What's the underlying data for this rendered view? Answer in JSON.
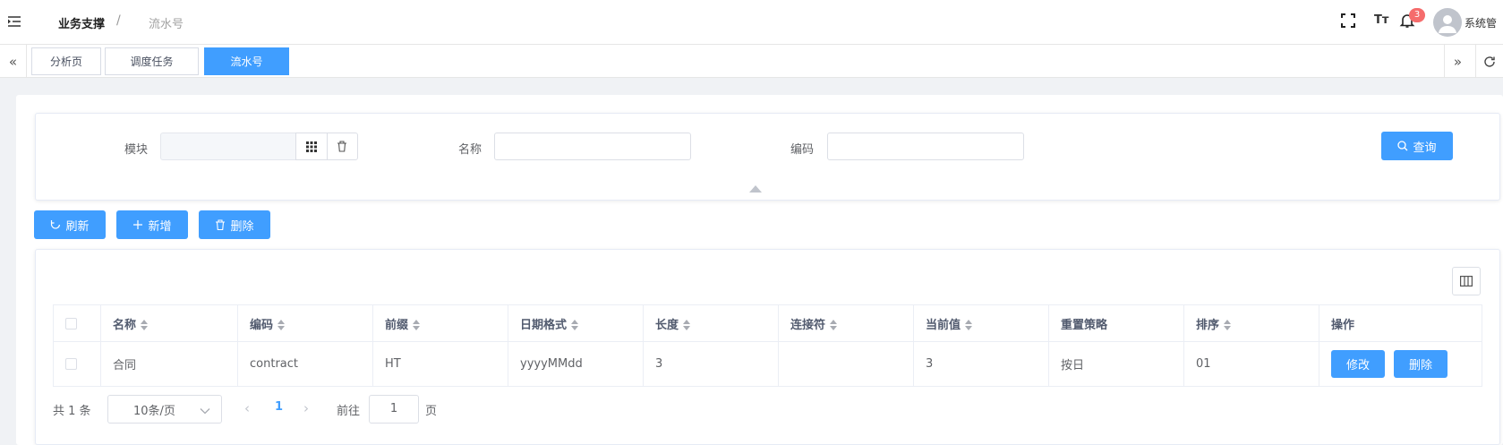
{
  "header": {
    "breadcrumb_main": "业务支撑",
    "breadcrumb_separator": "/",
    "breadcrumb_current": "流水号",
    "font_icon_text": "Tт",
    "notification_count": "3",
    "user_name": "系统管"
  },
  "tabs": [
    {
      "label": "分析页",
      "active": false
    },
    {
      "label": "调度任务",
      "active": false
    },
    {
      "label": "流水号",
      "active": true
    }
  ],
  "search": {
    "module_label": "模块",
    "module_value": "",
    "name_label": "名称",
    "name_value": "",
    "code_label": "编码",
    "code_value": "",
    "query_button": "查询"
  },
  "toolbar": {
    "refresh": "刷新",
    "add": "新增",
    "delete": "删除"
  },
  "table": {
    "columns": [
      "名称",
      "编码",
      "前缀",
      "日期格式",
      "长度",
      "连接符",
      "当前值",
      "重置策略",
      "排序",
      "操作"
    ],
    "rows": [
      {
        "name": "合同",
        "code": "contract",
        "prefix": "HT",
        "date_format": "yyyyMMdd",
        "length": "3",
        "connector": "",
        "current_value": "3",
        "reset_policy": "按日",
        "sort": "01",
        "edit": "修改",
        "delete": "删除"
      }
    ]
  },
  "pagination": {
    "total": "共 1 条",
    "page_size": "10条/页",
    "current_page": "1",
    "goto_label": "前往",
    "goto_value": "1",
    "page_suffix": "页"
  },
  "colors": {
    "primary": "#409eff",
    "badge": "#f56c6c"
  }
}
